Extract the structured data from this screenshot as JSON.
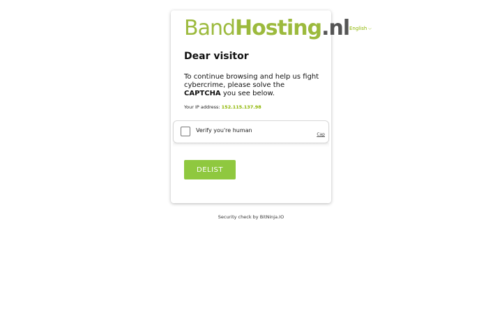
{
  "logo": {
    "band": "Band",
    "hosting": "Hosting",
    "tld": ".nl"
  },
  "language": {
    "selected": "English",
    "icon": "chevron-down-icon"
  },
  "card": {
    "title": "Dear visitor",
    "message_part1": "To continue browsing and help us fight cybercrime, please solve the",
    "message_bold": "CAPTCHA",
    "message_part2": "you see below.",
    "ip_label": "Your IP address:",
    "ip_value": "152.115.137.98"
  },
  "captcha": {
    "label": "Verify you're human",
    "link": "Cap"
  },
  "button": {
    "label": "DELIST"
  },
  "footer": {
    "text": "Security check by BitNinja.IO"
  },
  "colors": {
    "brand_green": "#9cba3d",
    "button_green": "#8fc83f",
    "link_green": "#8db600"
  }
}
